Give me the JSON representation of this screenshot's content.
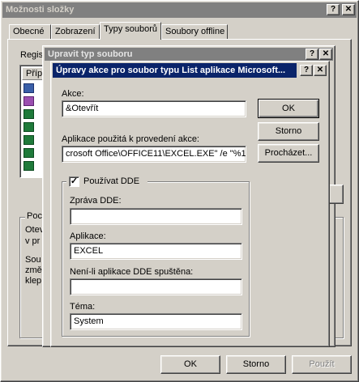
{
  "outer": {
    "title": "Možnosti složky",
    "tabs": [
      "Obecné",
      "Zobrazení",
      "Typy souborů",
      "Soubory offline"
    ],
    "reg_label": "Regis",
    "list_header": "Příp",
    "group_label": "Poc",
    "group_lines": [
      "Otev",
      "v pr",
      "",
      "Sou",
      "změ",
      "klep"
    ],
    "buttons": {
      "ok": "OK",
      "cancel": "Storno",
      "apply": "Použít"
    }
  },
  "middle": {
    "title": "Upravit typ souboru"
  },
  "dialog": {
    "title": "Úpravy akce pro soubor typu List aplikace Microsoft...",
    "action_label": "Akce:",
    "action_value": "&Otevřít",
    "app_label": "Aplikace použitá k provedení akce:",
    "app_value": "crosoft Office\\OFFICE11\\EXCEL.EXE\" /e \"%1\"",
    "browse_button": "Procházet...",
    "ok_button": "OK",
    "cancel_button": "Storno",
    "dde_checkbox_label": "Používat DDE",
    "dde_checked": true,
    "dde_message_label": "Zpráva DDE:",
    "dde_message_value": "",
    "application_label": "Aplikace:",
    "application_value": "EXCEL",
    "not_running_label": "Není-li aplikace DDE spuštěna:",
    "not_running_value": "",
    "topic_label": "Téma:",
    "topic_value": "System"
  },
  "caption_buttons": {
    "help": "?",
    "close": "✕"
  }
}
